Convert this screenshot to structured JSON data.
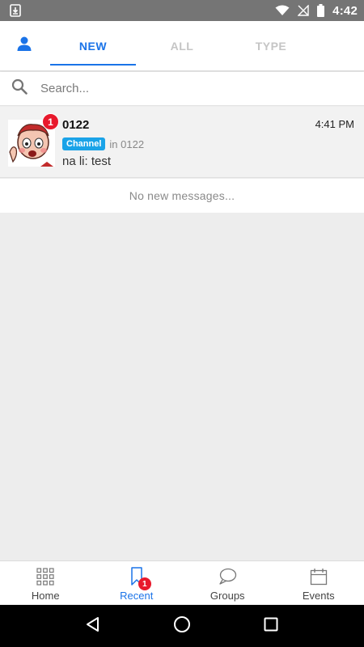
{
  "status_bar": {
    "time": "4:42",
    "icons": [
      "download-icon",
      "wifi-icon",
      "signal-off-icon",
      "battery-icon"
    ]
  },
  "tabs": {
    "profile_icon": "person-icon",
    "items": [
      {
        "label": "NEW",
        "active": true
      },
      {
        "label": "ALL",
        "active": false
      },
      {
        "label": "TYPE",
        "active": false
      }
    ]
  },
  "search": {
    "placeholder": "Search...",
    "icon": "search-icon"
  },
  "conversations": [
    {
      "name": "0122",
      "unread": "1",
      "time": "4:41 PM",
      "tag": "Channel",
      "location": "in 0122",
      "preview": "na li: test"
    }
  ],
  "empty_notice": "No new messages...",
  "bottom_nav": {
    "items": [
      {
        "label": "Home",
        "icon": "grid-icon",
        "active": false
      },
      {
        "label": "Recent",
        "icon": "bookmark-icon",
        "active": true,
        "badge": "1"
      },
      {
        "label": "Groups",
        "icon": "chat-bubbles-icon",
        "active": false
      },
      {
        "label": "Events",
        "icon": "calendar-icon",
        "active": false
      }
    ]
  },
  "colors": {
    "accent": "#1a73e8",
    "badge": "#e8192c",
    "channel_tag": "#1aa3e8",
    "status_bar": "#757575"
  }
}
